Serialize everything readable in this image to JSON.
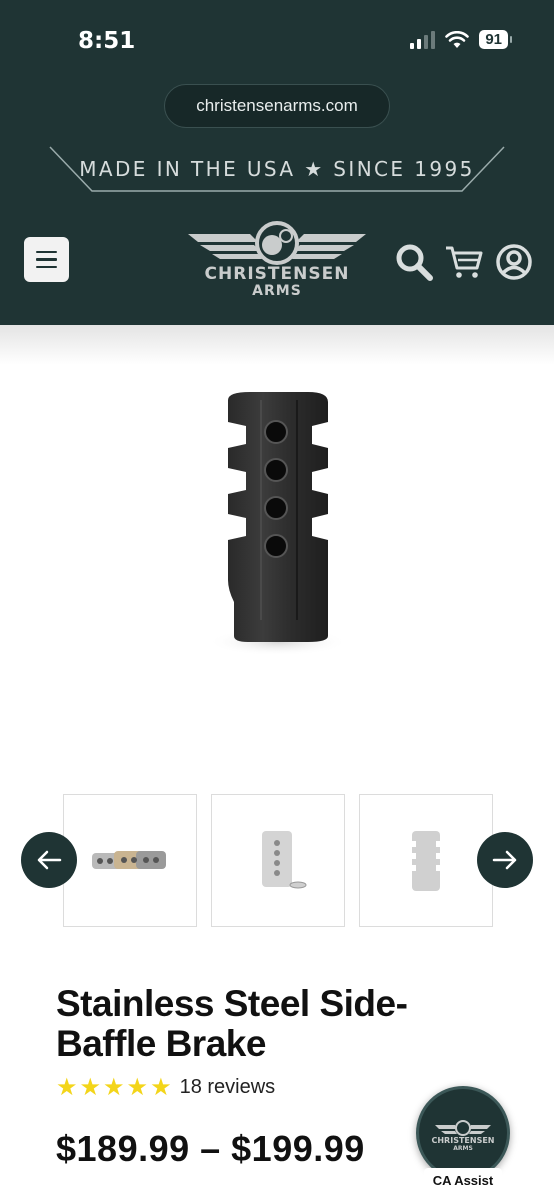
{
  "status_bar": {
    "time": "8:51",
    "battery": "91"
  },
  "browser": {
    "url": "christensenarms.com"
  },
  "banner": {
    "text": "MADE IN THE USA ★ SINCE 1995"
  },
  "brand": {
    "line1": "CHRISTENSEN",
    "line2": "ARMS"
  },
  "header_icons": [
    "menu-icon",
    "search-icon",
    "cart-icon",
    "account-icon"
  ],
  "gallery": {
    "thumbnails": [
      {
        "name": "brake-finish-variants"
      },
      {
        "name": "brake-with-washer"
      },
      {
        "name": "brake-side-view"
      }
    ]
  },
  "product": {
    "title": "Stainless Steel Side-Baffle Brake",
    "rating": 5,
    "reviews": "18 reviews",
    "price": "$189.99 – $199.99"
  },
  "assist": {
    "label": "CA Assist",
    "brand_line1": "CHRISTENSEN",
    "brand_line2": "ARMS"
  },
  "colors": {
    "header_bg": "#1f3434",
    "star": "#f3d51a"
  }
}
